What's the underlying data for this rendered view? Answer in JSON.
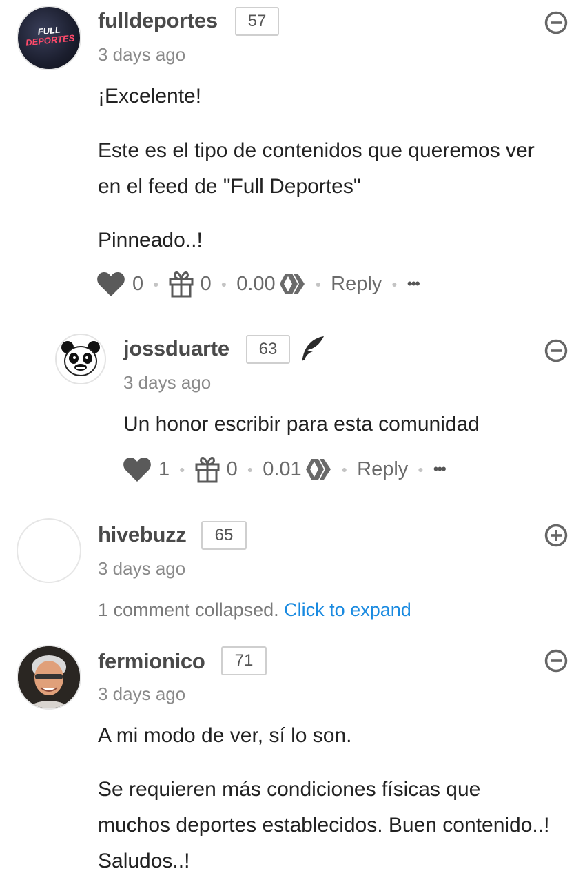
{
  "comments": [
    {
      "username": "fulldeportes",
      "reputation": "57",
      "time": "3 days ago",
      "avatar_text": "FULL DEPORTES",
      "paragraphs": [
        "¡Excelente!",
        "Este es el tipo de contenidos que queremos ver en el feed de \"Full Deportes\"",
        "Pinneado..!"
      ],
      "votes": "0",
      "gifts": "0",
      "payout": "0.00",
      "reply_label": "Reply",
      "more_label": "•••"
    },
    {
      "username": "jossduarte",
      "reputation": "63",
      "time": "3 days ago",
      "paragraphs": [
        "Un honor escribir para esta comunidad"
      ],
      "votes": "1",
      "gifts": "0",
      "payout": "0.01",
      "reply_label": "Reply",
      "more_label": "•••"
    },
    {
      "username": "hivebuzz",
      "reputation": "65",
      "time": "3 days ago",
      "collapsed_text": "1 comment collapsed.",
      "expand_label": "Click to expand"
    },
    {
      "username": "fermionico",
      "reputation": "71",
      "time": "3 days ago",
      "paragraphs": [
        "A mi modo de ver, sí lo son.",
        "Se requieren más condiciones físicas que muchos deportes establecidos. Buen contenido..! Saludos..!"
      ]
    }
  ]
}
